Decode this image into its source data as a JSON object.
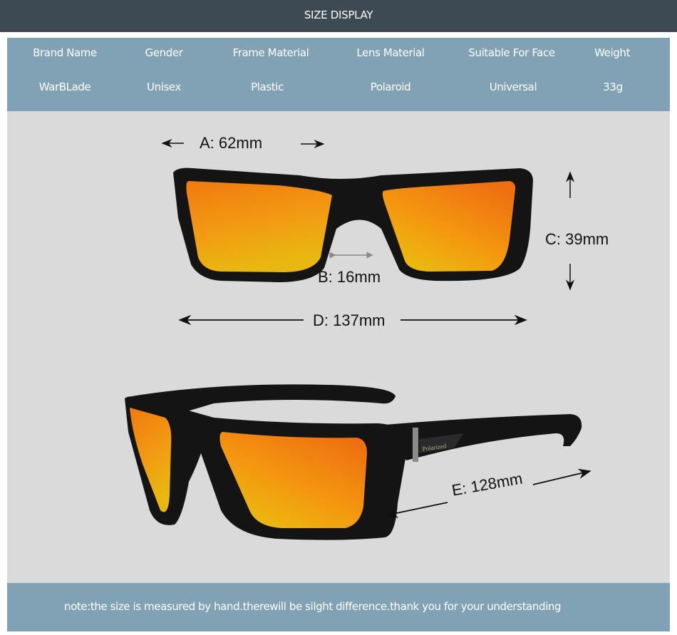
{
  "header": {
    "title": "SIZE DISPLAY"
  },
  "specs": {
    "columns": [
      {
        "label": "Brand Name",
        "value": "WarBLade"
      },
      {
        "label": "Gender",
        "value": "Unisex"
      },
      {
        "label": "Frame Material",
        "value": "Plastic"
      },
      {
        "label": "Lens Material",
        "value": "Polaroid"
      },
      {
        "label": "Suitable For Face",
        "value": "Universal"
      },
      {
        "label": "Weight",
        "value": "33g"
      }
    ]
  },
  "dimensions": {
    "a": "A: 62mm",
    "b": "B: 16mm",
    "c": "C: 39mm",
    "d": "D: 137mm",
    "e": "E: 128mm"
  },
  "product": {
    "temple_logo": "Polarized"
  },
  "footer": {
    "note": "note:the size is measured by hand.therewill be silght difference.thank you for your understanding"
  },
  "colors": {
    "header_bg": "#3d4a54",
    "panel_bg": "#81a2b5",
    "stage_bg": "#dadada",
    "lens_orange": "#f08a10",
    "frame": "#111111"
  }
}
